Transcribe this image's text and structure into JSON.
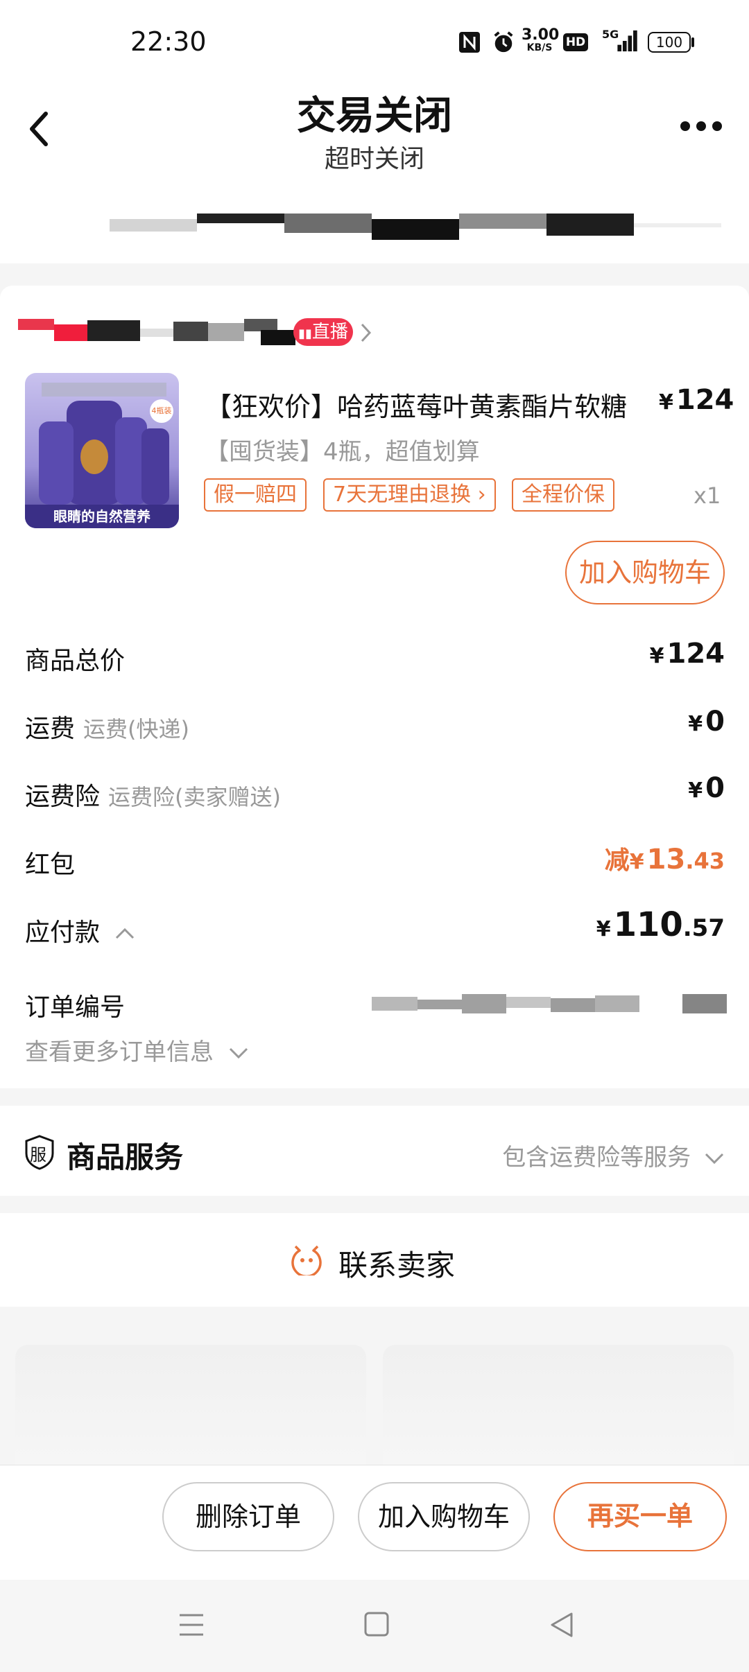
{
  "status_bar": {
    "time": "22:30",
    "speed": "3.00",
    "speed_unit": "KB/S",
    "hd": "HD",
    "network": "5G",
    "battery": "100"
  },
  "header": {
    "title": "交易关闭",
    "subtitle": "超时关闭"
  },
  "shop": {
    "live_badge": "直播"
  },
  "product": {
    "image_caption": "眼睛的自然营养",
    "image_badge": "4瓶装",
    "title": "【狂欢价】哈药蓝莓叶黄素酯片软糖",
    "price": "124",
    "spec": "【囤货装】4瓶，超值划算",
    "tags": [
      "假一赔四",
      "7天无理由退换",
      "全程价保"
    ],
    "quantity": "x1",
    "add_cart_label": "加入购物车"
  },
  "summary": {
    "currency": "¥",
    "total_label": "商品总价",
    "total_value": "124",
    "shipping_label": "运费",
    "shipping_sub": "运费(快递)",
    "shipping_value": "0",
    "insurance_label": "运费险",
    "insurance_sub": "运费险(卖家赠送)",
    "insurance_value": "0",
    "redpacket_label": "红包",
    "redpacket_prefix": "减",
    "redpacket_int": "13",
    "redpacket_dec": ".43",
    "payable_label": "应付款",
    "payable_int": "110",
    "payable_dec": ".57",
    "order_no_label": "订单编号",
    "more_info_label": "查看更多订单信息"
  },
  "services": {
    "icon_char": "服",
    "label": "商品服务",
    "summary": "包含运费险等服务"
  },
  "contact": {
    "label": "联系卖家"
  },
  "actions": {
    "delete_label": "删除订单",
    "add_cart_label": "加入购物车",
    "rebuy_label": "再买一单"
  },
  "colors": {
    "accent": "#e8733a",
    "live_badge": "#f0344d"
  }
}
